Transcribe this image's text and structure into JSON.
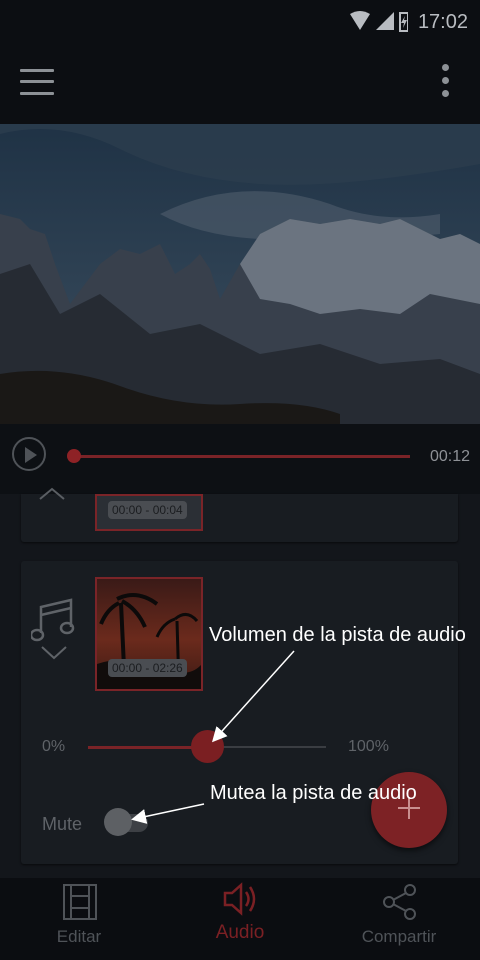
{
  "status_bar": {
    "time": "17:02"
  },
  "app_bar": {
    "menu_icon": "hamburger-menu-icon",
    "overflow_icon": "more-vertical-icon"
  },
  "player": {
    "duration": "00:12",
    "progress": 0.0
  },
  "clips": [
    {
      "time_range": "00:00 - 00:04"
    },
    {
      "time_range": "00:00 - 02:26"
    }
  ],
  "volume": {
    "min_label": "0%",
    "max_label": "100%",
    "level": 0.37
  },
  "mute": {
    "label": "Mute",
    "enabled": false
  },
  "annotations": {
    "volume": "Volumen de la pista de audio",
    "mute": "Mutea la pista de audio"
  },
  "fab": {
    "icon": "plus-icon"
  },
  "bottom_nav": {
    "items": [
      {
        "label": "Editar",
        "icon": "film-icon"
      },
      {
        "label": "Audio",
        "icon": "speaker-icon",
        "active": true
      },
      {
        "label": "Compartir",
        "icon": "share-icon"
      }
    ]
  },
  "colors": {
    "accent": "#7b1f22",
    "background": "#111419"
  }
}
